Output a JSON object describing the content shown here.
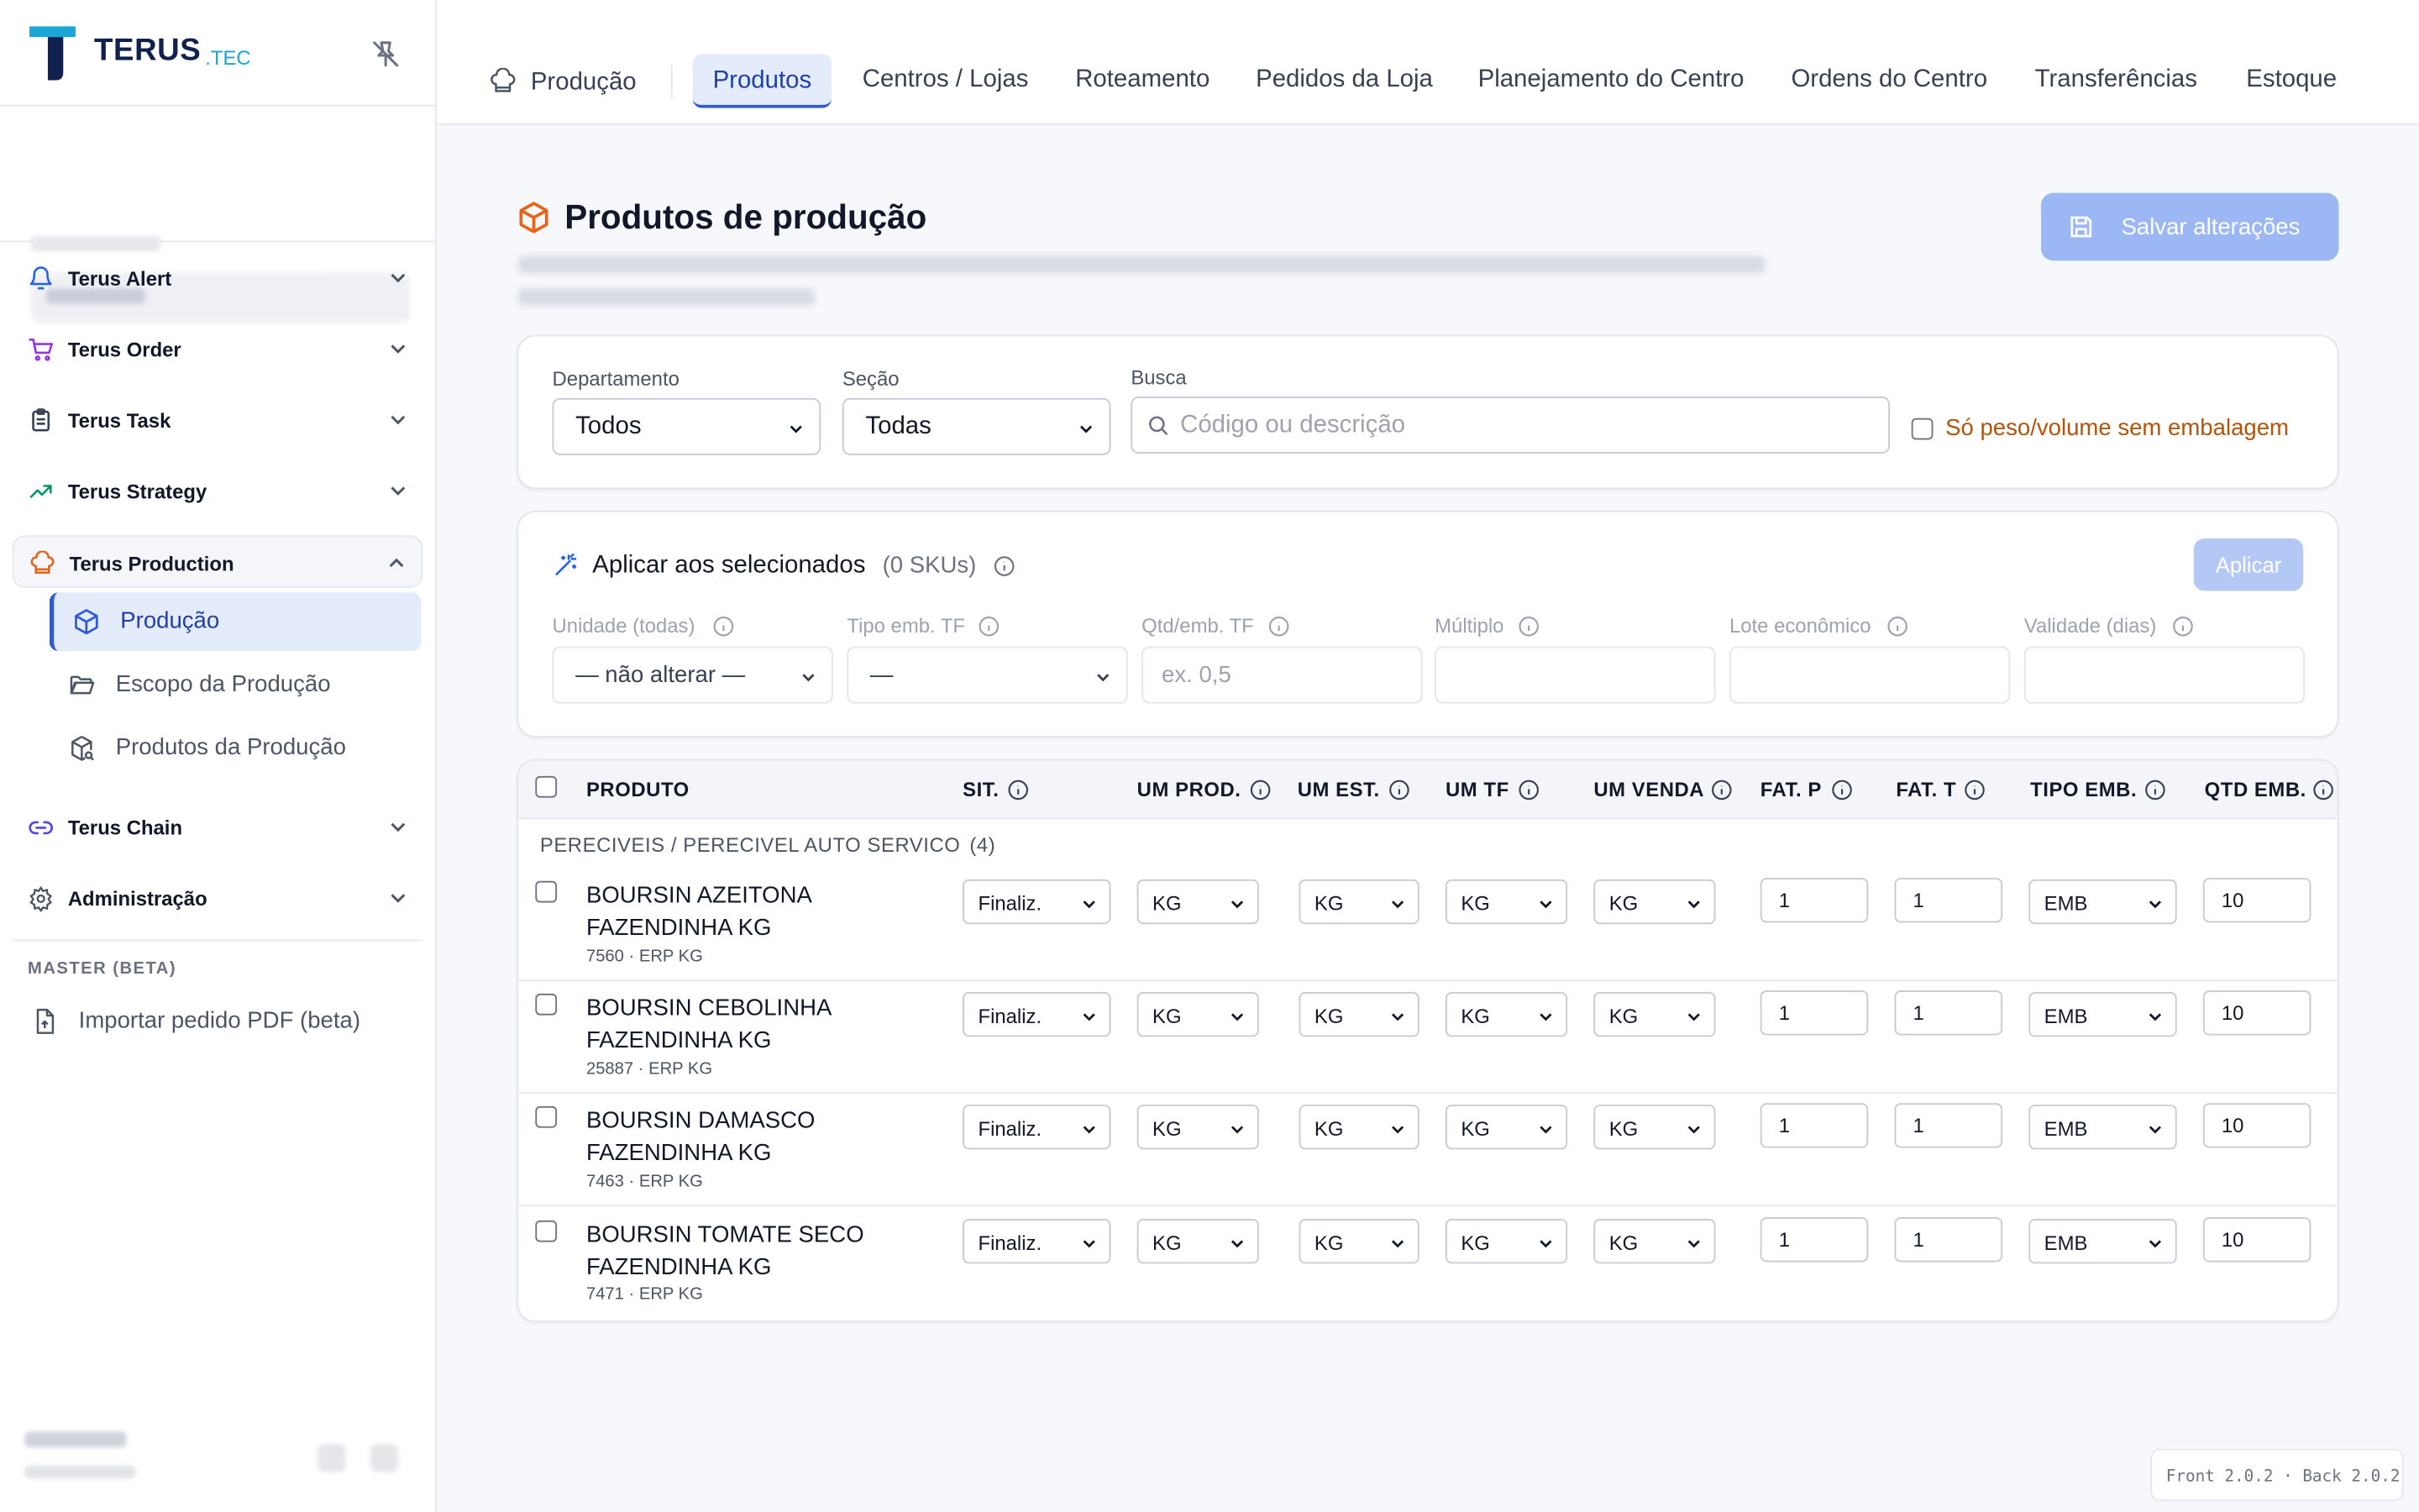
{
  "brand": {
    "name": "TERUS",
    "tld": ".TEC"
  },
  "sidebar": {
    "items": [
      {
        "label": "Terus Alert",
        "icon": "bell-icon"
      },
      {
        "label": "Terus Order",
        "icon": "cart-icon"
      },
      {
        "label": "Terus Task",
        "icon": "clipboard-icon"
      },
      {
        "label": "Terus Strategy",
        "icon": "trend-up-icon"
      },
      {
        "label": "Terus Production",
        "icon": "chef-hat-icon",
        "open": true
      },
      {
        "label": "Terus Chain",
        "icon": "link-icon"
      },
      {
        "label": "Administração",
        "icon": "gear-icon"
      }
    ],
    "sub_items": [
      {
        "label": "Produção",
        "icon": "cube-icon",
        "active": true
      },
      {
        "label": "Escopo da Produção",
        "icon": "folder-open-icon"
      },
      {
        "label": "Produtos da Produção",
        "icon": "package-search-icon"
      }
    ],
    "section_label": "MASTER (BETA)",
    "import_label": "Importar pedido PDF (beta)"
  },
  "topbar": {
    "breadcrumb": "Produção",
    "tabs": [
      {
        "label": "Produtos",
        "active": true
      },
      {
        "label": "Centros / Lojas"
      },
      {
        "label": "Roteamento"
      },
      {
        "label": "Pedidos da Loja"
      },
      {
        "label": "Planejamento do Centro"
      },
      {
        "label": "Ordens do Centro"
      },
      {
        "label": "Transferências"
      },
      {
        "label": "Estoque"
      }
    ]
  },
  "page": {
    "title": "Produtos de produção",
    "save_label": "Salvar alterações"
  },
  "filters": {
    "department_label": "Departamento",
    "department_value": "Todos",
    "section_label": "Seção",
    "section_value": "Todas",
    "search_label": "Busca",
    "search_placeholder": "Código ou descrição",
    "weight_only_label": "Só peso/volume sem embalagem"
  },
  "bulk": {
    "title": "Aplicar aos selecionados",
    "count": "(0 SKUs)",
    "apply_label": "Aplicar",
    "fields": [
      {
        "label": "Unidade (todas)",
        "value": "— não alterar —",
        "kind": "select"
      },
      {
        "label": "Tipo emb. TF",
        "value": "—",
        "kind": "select"
      },
      {
        "label": "Qtd/emb. TF",
        "placeholder": "ex. 0,5",
        "kind": "input"
      },
      {
        "label": "Múltiplo",
        "placeholder": "",
        "kind": "input"
      },
      {
        "label": "Lote econômico",
        "placeholder": "",
        "kind": "input"
      },
      {
        "label": "Validade (dias)",
        "placeholder": "",
        "kind": "input"
      }
    ]
  },
  "table": {
    "headers": [
      "PRODUTO",
      "SIT.",
      "UM PROD.",
      "UM EST.",
      "UM TF",
      "UM VENDA",
      "FAT. P",
      "FAT. T",
      "TIPO EMB.",
      "QTD EMB."
    ],
    "group": {
      "label": "PERECIVEIS / PERECIVEL AUTO SERVICO",
      "count": "(4)"
    },
    "rows": [
      {
        "name": "BOURSIN AZEITONA FAZENDINHA KG",
        "meta": "7560 · ERP KG",
        "sit": "Finaliz.",
        "um_prod": "KG",
        "um_est": "KG",
        "um_tf": "KG",
        "um_venda": "KG",
        "fat_p": "1",
        "fat_t": "1",
        "tipo_emb": "EMB",
        "qtd_emb": "10"
      },
      {
        "name": "BOURSIN CEBOLINHA FAZENDINHA KG",
        "meta": "25887 · ERP KG",
        "sit": "Finaliz.",
        "um_prod": "KG",
        "um_est": "KG",
        "um_tf": "KG",
        "um_venda": "KG",
        "fat_p": "1",
        "fat_t": "1",
        "tipo_emb": "EMB",
        "qtd_emb": "10"
      },
      {
        "name": "BOURSIN DAMASCO FAZENDINHA KG",
        "meta": "7463 · ERP KG",
        "sit": "Finaliz.",
        "um_prod": "KG",
        "um_est": "KG",
        "um_tf": "KG",
        "um_venda": "KG",
        "fat_p": "1",
        "fat_t": "1",
        "tipo_emb": "EMB",
        "qtd_emb": "10"
      },
      {
        "name": "BOURSIN TOMATE SECO FAZENDINHA KG",
        "meta": "7471 · ERP KG",
        "sit": "Finaliz.",
        "um_prod": "KG",
        "um_est": "KG",
        "um_tf": "KG",
        "um_venda": "KG",
        "fat_p": "1",
        "fat_t": "1",
        "tipo_emb": "EMB",
        "qtd_emb": "10"
      }
    ]
  },
  "version": "Front 2.0.2 · Back 2.0.2",
  "colors": {
    "accent": "#2f5bd6",
    "brand": "#10214f",
    "production": "#e8641b",
    "warning_text": "#b45309"
  }
}
